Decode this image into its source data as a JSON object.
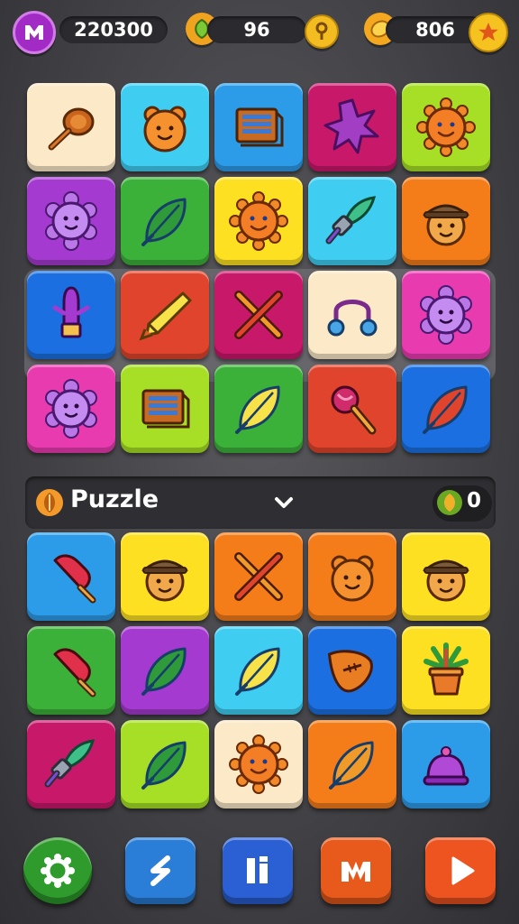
{
  "hud": {
    "score": "220300",
    "gems": "96",
    "coins": "806"
  },
  "bar": {
    "title": "Puzzle",
    "count": "0"
  },
  "colors": {
    "cream": "#fbe9c8",
    "cyan": "#3fcdf2",
    "blue": "#2c9be8",
    "magenta": "#c8186a",
    "lime": "#a6df25",
    "purple": "#a43ad0",
    "green": "#3cb13a",
    "yellow": "#fde022",
    "orange": "#f47d1a",
    "royal": "#1b6fe0",
    "red": "#e0442d",
    "pink": "#e93bb0"
  },
  "tiles_top": [
    {
      "color": "cream",
      "icon": "frying-pan-icon"
    },
    {
      "color": "cyan",
      "icon": "teddy-face-icon"
    },
    {
      "color": "blue",
      "icon": "book-icon"
    },
    {
      "color": "magenta",
      "icon": "star-burst-icon"
    },
    {
      "color": "lime",
      "icon": "sun-face-icon"
    },
    {
      "color": "purple",
      "icon": "flower-face-icon"
    },
    {
      "color": "green",
      "icon": "leaf-icon"
    },
    {
      "color": "yellow",
      "icon": "sun-face-icon"
    },
    {
      "color": "cyan",
      "icon": "brush-icon"
    },
    {
      "color": "orange",
      "icon": "hat-face-icon"
    },
    {
      "color": "royal",
      "icon": "crayon-icon"
    },
    {
      "color": "red",
      "icon": "pencil-icon"
    },
    {
      "color": "magenta",
      "icon": "crossed-pencils-icon"
    },
    {
      "color": "cream",
      "icon": "headphones-icon"
    },
    {
      "color": "pink",
      "icon": "flower-face-icon"
    },
    {
      "color": "pink",
      "icon": "flower-face-icon"
    },
    {
      "color": "lime",
      "icon": "book-icon"
    },
    {
      "color": "green",
      "icon": "leaf-icon"
    },
    {
      "color": "red",
      "icon": "lollipop-icon"
    },
    {
      "color": "royal",
      "icon": "leaf-icon"
    }
  ],
  "tiles_bottom": [
    {
      "color": "blue",
      "icon": "popsicle-icon"
    },
    {
      "color": "yellow",
      "icon": "hat-face-icon"
    },
    {
      "color": "orange",
      "icon": "crossed-pencils-icon"
    },
    {
      "color": "orange",
      "icon": "teddy-face-icon"
    },
    {
      "color": "yellow",
      "icon": "hat-face-icon"
    },
    {
      "color": "green",
      "icon": "popsicle-icon"
    },
    {
      "color": "purple",
      "icon": "leaf-icon"
    },
    {
      "color": "cyan",
      "icon": "leaf-icon"
    },
    {
      "color": "royal",
      "icon": "football-icon"
    },
    {
      "color": "yellow",
      "icon": "potted-plant-icon"
    },
    {
      "color": "magenta",
      "icon": "brush-icon"
    },
    {
      "color": "lime",
      "icon": "leaf-icon"
    },
    {
      "color": "cream",
      "icon": "sun-face-icon"
    },
    {
      "color": "orange",
      "icon": "leaf-icon"
    },
    {
      "color": "blue",
      "icon": "bell-icon"
    }
  ],
  "bottom_buttons": [
    {
      "name": "settings-button",
      "icon": "settings-icon",
      "color": "#2f9b2c"
    },
    {
      "name": "shuffle-button",
      "icon": "s-icon",
      "color": "#2a7ed8"
    },
    {
      "name": "pause-button",
      "icon": "pause-icon",
      "color": "#2a60d4"
    },
    {
      "name": "level-button",
      "icon": "m-icon",
      "color": "#e85a1c"
    },
    {
      "name": "play-button",
      "icon": "play-icon",
      "color": "#ee5420"
    }
  ]
}
